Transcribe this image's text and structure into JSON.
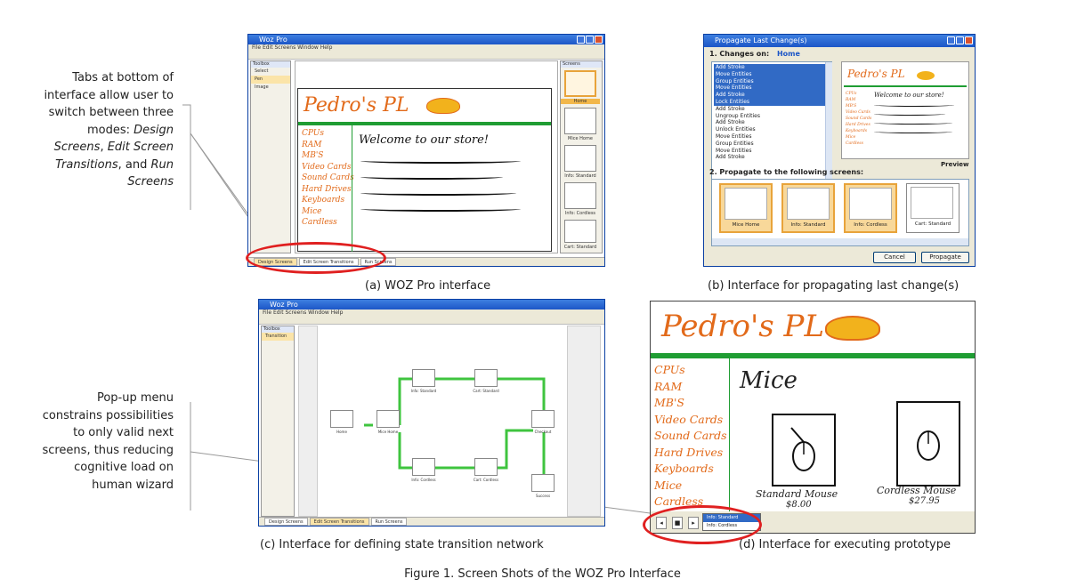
{
  "annotations": {
    "tabs_text": [
      "Tabs at bottom of",
      "interface allow user to",
      "switch between three",
      "modes: "
    ],
    "tabs_italic_1": "Design",
    "tabs_italic_1b": "Screens",
    "tabs_sep_1": ", ",
    "tabs_italic_2a": "Edit Screen",
    "tabs_italic_2b": "Transitions",
    "tabs_sep_2": ", and ",
    "tabs_italic_3a": "Run",
    "tabs_italic_3b": "Screens",
    "popup_text": [
      "Pop-up menu",
      "constrains possibilities",
      "to only valid next",
      "screens, thus reducing",
      "cognitive load on",
      "human wizard"
    ]
  },
  "captions": {
    "a": "(a) WOZ Pro interface",
    "b": "(b) Interface for propagating last change(s)",
    "c": "(c) Interface for defining state transition network",
    "d": "(d) Interface for executing prototype",
    "figure": "Figure 1. Screen Shots of the WOZ Pro Interface"
  },
  "panel_a": {
    "title": "Woz Pro",
    "menu": "File   Edit   Screens   Window   Help",
    "toolbox_title": "Toolbox",
    "tools": [
      "Select",
      "Pen",
      "Image"
    ],
    "screens_title": "Screens",
    "screen_labels": [
      "Home",
      "Mice Home",
      "Info: Standard",
      "Info: Cordless",
      "Cart: Standard"
    ],
    "tabs": [
      "Design Screens",
      "Edit Screen Transitions",
      "Run Screens"
    ]
  },
  "sketch": {
    "brand": "Pedro's PL",
    "nav": [
      "CPUs",
      "RAM",
      "MB'S",
      "Video Cards",
      "Sound Cards",
      "Hard Drives",
      "Keyboards",
      "Mice",
      "Cardless"
    ],
    "welcome": "Welcome to our store!",
    "mice_heading": "Mice",
    "standard_mouse": "Standard Mouse",
    "standard_price": "$8.00",
    "cordless_mouse": "Cordless Mouse",
    "cordless_price": "$27.95"
  },
  "panel_b": {
    "title": "Propagate Last Change(s)",
    "step1": "1. Changes on:",
    "step1_target": "Home",
    "changes": [
      "Add Stroke",
      "Move Entities",
      "Group Entities",
      "Move Entities",
      "Add Stroke",
      "Lock Entities",
      "Add Stroke",
      "Ungroup Entities",
      "Add Stroke",
      "Unlock Entities",
      "Move Entities",
      "Group Entities",
      "Move Entities",
      "Add Stroke"
    ],
    "selected_count": 6,
    "preview_label": "Preview",
    "step2": "2. Propagate to the following screens:",
    "targets": [
      {
        "label": "Mice Home",
        "selected": true
      },
      {
        "label": "Info: Standard",
        "selected": true
      },
      {
        "label": "Info: Cordless",
        "selected": true
      },
      {
        "label": "Cart: Standard",
        "selected": false
      }
    ],
    "cancel": "Cancel",
    "propagate": "Propagate"
  },
  "panel_c": {
    "title": "Woz Pro",
    "menu": "File   Edit   Screens   Window   Help",
    "toolbox_title": "Toolbox",
    "tool": "Transition",
    "nodes": [
      "Home",
      "Mice Home",
      "Info: Standard",
      "Cart: Standard",
      "Checkout",
      "Info: Cordless",
      "Cart: Cordless",
      "Success"
    ],
    "tabs": [
      "Design Screens",
      "Edit Screen Transitions",
      "Run Screens"
    ]
  },
  "panel_d": {
    "popup_items": [
      "Info: Standard",
      "Info: Cordless"
    ]
  },
  "colors": {
    "highlight_ring": "#e02020",
    "sketch_orange": "#e26a1a",
    "sketch_green": "#1f9d33",
    "xp_blue": "#1c56c7",
    "selection_orange": "#e8a33a"
  }
}
